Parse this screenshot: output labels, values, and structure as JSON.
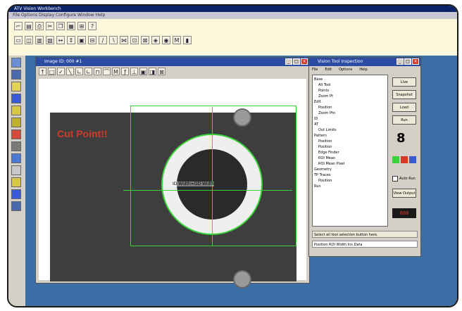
{
  "app": {
    "title": "ATV Vision Workbench",
    "menu": "File  Options  Display  Configure  Window  Help"
  },
  "image_window": {
    "title": "Image ID: 000 #1"
  },
  "overlay": {
    "cut_label": "Cut Point!!",
    "ring_label": "ID Width=OD Width"
  },
  "hud_window": {
    "title": "Vision Tool Inspection",
    "menu": [
      "File",
      "Edit",
      "Options",
      "Help"
    ],
    "tree": [
      "Base",
      "All Tool",
      "Points",
      "Zoom Pt",
      "Edit",
      "Position",
      "Zoom Ptn",
      "ID",
      "AT",
      "Out Limits",
      "Pattern",
      "Position",
      "Position",
      "Edge Finder",
      "ROI Mean",
      "ROI Mean Pixel",
      "Geometry",
      "TP Traces",
      "Position",
      "Run"
    ],
    "buttons": [
      "Live",
      "Snapshot",
      "Load",
      "Run"
    ],
    "checkbox_label": "Auto Run",
    "view_button": "View Output",
    "status": "Select all tool selection button here.",
    "status2": "Position ROI Width Ins Data",
    "counter": "888"
  }
}
